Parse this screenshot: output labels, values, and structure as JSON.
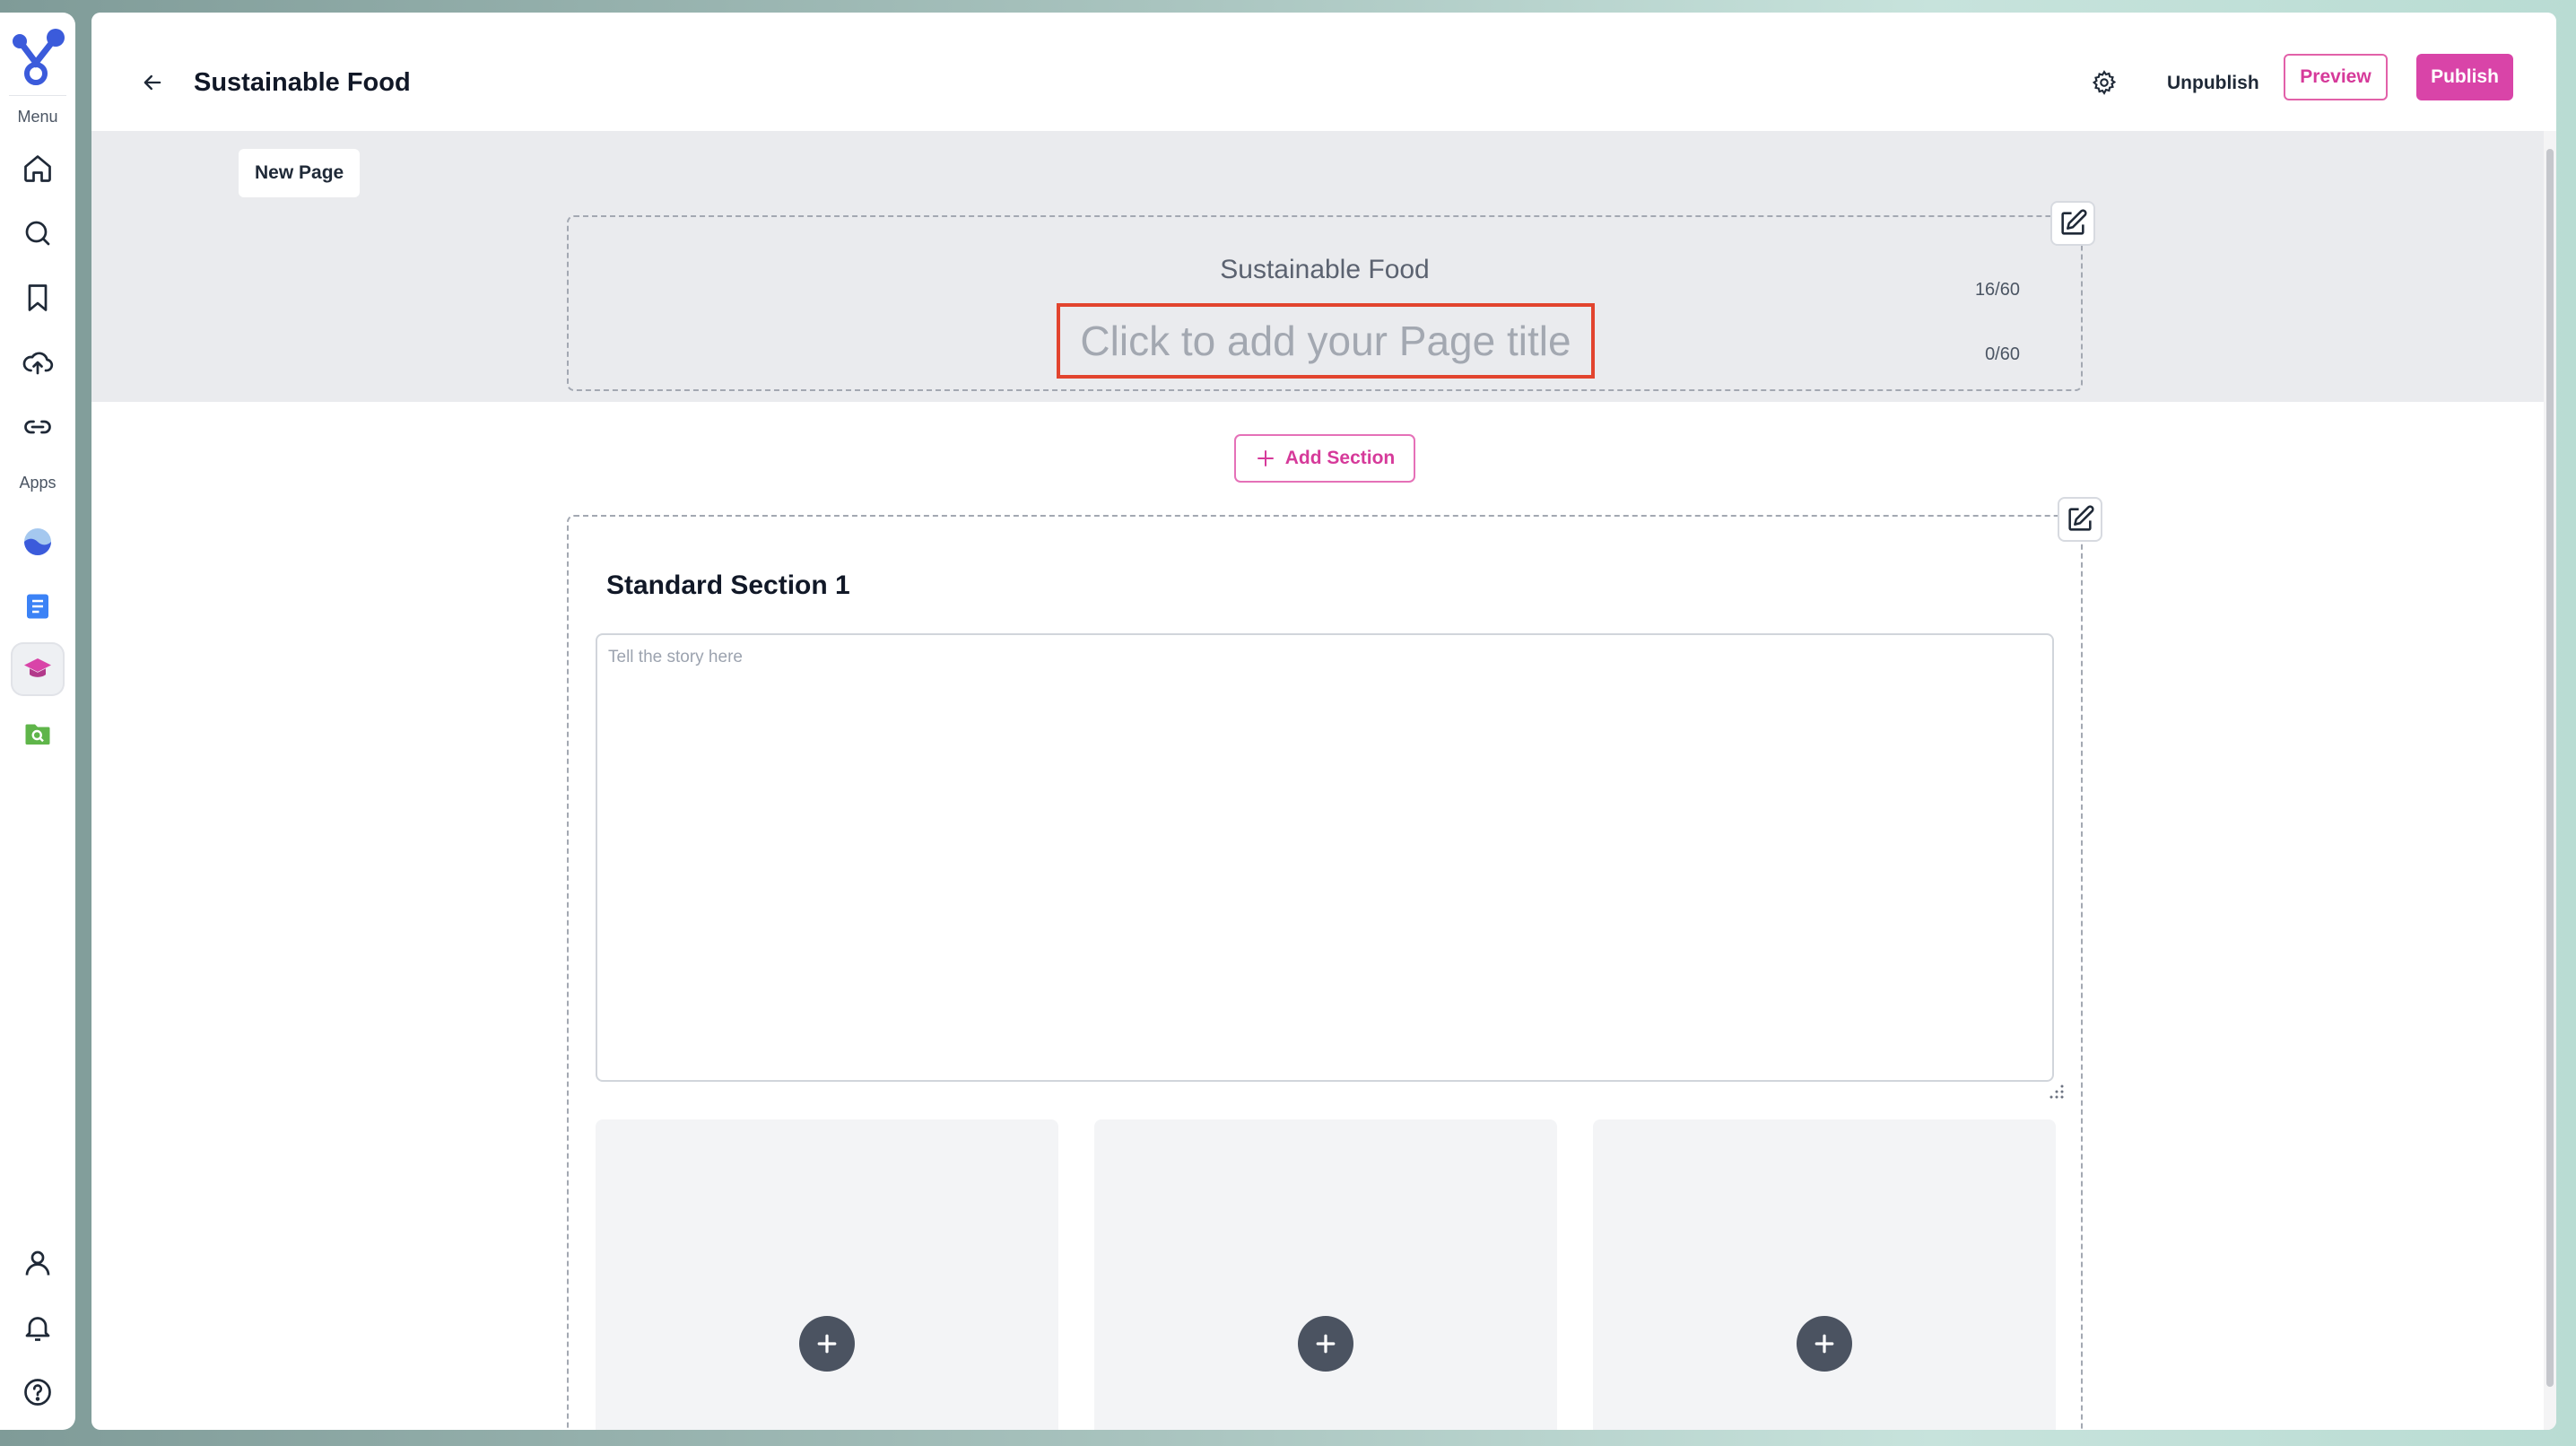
{
  "rail": {
    "menu_label": "Menu",
    "apps_label": "Apps",
    "menu_items": [
      {
        "icon": "home-icon"
      },
      {
        "icon": "search-icon"
      },
      {
        "icon": "bookmark-icon"
      },
      {
        "icon": "upload-cloud-icon"
      },
      {
        "icon": "link-icon"
      }
    ],
    "app_items": [
      {
        "icon": "wave-app-icon",
        "color": "#3b5bdb"
      },
      {
        "icon": "document-app-icon",
        "color": "#3b82f6"
      },
      {
        "icon": "graduation-cap-app-icon",
        "color": "#d944a8",
        "active": true
      },
      {
        "icon": "folder-search-app-icon",
        "color": "#5fb54a"
      }
    ],
    "bottom_items": [
      {
        "icon": "user-icon"
      },
      {
        "icon": "bell-icon"
      },
      {
        "icon": "help-icon"
      }
    ]
  },
  "header": {
    "title": "Sustainable Food",
    "unpublish_label": "Unpublish",
    "preview_label": "Preview",
    "publish_label": "Publish"
  },
  "editor": {
    "tab_label": "New Page",
    "subtitle": "Sustainable Food",
    "subtitle_counter": "16/60",
    "title_placeholder": "Click to add your Page title",
    "title_value": "",
    "title_counter": "0/60",
    "add_section_label": "Add Section",
    "section": {
      "title": "Standard Section 1",
      "story_placeholder": "Tell the story here",
      "media_slots": 3
    }
  },
  "colors": {
    "accent": "#d944a8",
    "highlight_border": "#e2442e",
    "header_band": "#eaebee"
  }
}
